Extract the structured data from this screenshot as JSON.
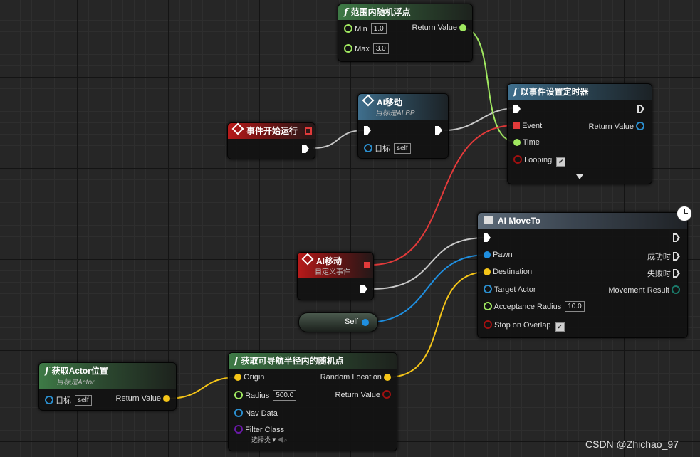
{
  "colors": {
    "exec": "#ffffff",
    "float": "#a0e860",
    "object": "#1f8fe0",
    "vector": "#f5c518",
    "boolean": "#a01010",
    "delegate": "#e23a3a",
    "class": "#6a1aa8",
    "enum": "#1a7a6a"
  },
  "nodes": {
    "random_float": {
      "title": "范围内随机浮点",
      "icon": "function-icon",
      "min_label": "Min",
      "min_value": "1.0",
      "max_label": "Max",
      "max_value": "3.0",
      "return_label": "Return Value"
    },
    "begin_play": {
      "title": "事件开始运行",
      "icon": "event-icon"
    },
    "ai_move_call": {
      "title": "AI移动",
      "subtitle": "目标是AI BP",
      "icon": "event-icon",
      "target_label": "目标",
      "target_value": "self"
    },
    "set_timer": {
      "title": "以事件设置定时器",
      "icon": "function-icon",
      "event_label": "Event",
      "time_label": "Time",
      "looping_label": "Looping",
      "return_label": "Return Value",
      "looping_checked": true
    },
    "ai_move_event": {
      "title": "AI移动",
      "subtitle": "自定义事件",
      "icon": "event-icon"
    },
    "self_node": {
      "label": "Self"
    },
    "ai_move_to": {
      "title": "AI MoveTo",
      "icon": "latent-icon",
      "pawn_label": "Pawn",
      "destination_label": "Destination",
      "target_actor_label": "Target Actor",
      "acceptance_radius_label": "Acceptance Radius",
      "acceptance_radius_value": "10.0",
      "stop_on_overlap_label": "Stop on Overlap",
      "stop_on_overlap_checked": true,
      "on_success_label": "成功时",
      "on_fail_label": "失败时",
      "movement_result_label": "Movement Result"
    },
    "get_actor_location": {
      "title": "获取Actor位置",
      "subtitle": "目标是Actor",
      "icon": "function-icon",
      "target_label": "目标",
      "target_value": "self",
      "return_label": "Return Value"
    },
    "random_reachable": {
      "title": "获取可导航半径内的随机点",
      "icon": "function-icon",
      "origin_label": "Origin",
      "radius_label": "Radius",
      "radius_value": "500.0",
      "nav_data_label": "Nav Data",
      "filter_class_label": "Filter Class",
      "filter_class_value": "选择类",
      "random_location_label": "Random Location",
      "return_label": "Return Value"
    }
  },
  "watermark": "CSDN @Zhichao_97"
}
